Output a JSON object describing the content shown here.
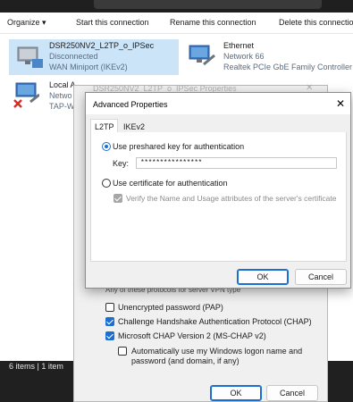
{
  "toolbar": {
    "organize": "Organize ▾",
    "start": "Start this connection",
    "rename": "Rename this connection",
    "delete": "Delete this connectio"
  },
  "connections": [
    {
      "title": "DSR250NV2_L2TP_o_IPSec",
      "line2": "Disconnected",
      "line3": "WAN Miniport (IKEv2)"
    },
    {
      "title": "Ethernet",
      "line2": "Network 66",
      "line3": "Realtek PCIe GbE Family Controller"
    },
    {
      "title": "Local A",
      "line2": "Netwo",
      "line3": "TAP-W"
    }
  ],
  "status_bar": {
    "text": "6 items  |  1 item"
  },
  "back_dialog": {
    "title": "DSR250NV2_L2TP_o_IPSec Properties",
    "close": "✕",
    "partial_label": "Any of these protocols for server VPN type",
    "options": [
      {
        "label": "Unencrypted password (PAP)",
        "checked": false
      },
      {
        "label": "Challenge Handshake Authentication Protocol (CHAP)",
        "checked": true
      },
      {
        "label": "Microsoft CHAP Version 2 (MS-CHAP v2)",
        "checked": true
      }
    ],
    "auto_logon_line1": "Automatically use my Windows logon name and",
    "auto_logon_line2": "password (and domain, if any)",
    "ok": "OK",
    "cancel": "Cancel"
  },
  "advanced": {
    "title": "Advanced Properties",
    "close": "✕",
    "tabs": [
      "L2TP",
      "IKEv2"
    ],
    "radio_psk": "Use preshared key for authentication",
    "key_label": "Key:",
    "key_value": "****************",
    "radio_cert": "Use certificate for authentication",
    "verify_label": "Verify the Name and Usage attributes of the server's certificate",
    "ok": "OK",
    "cancel": "Cancel"
  },
  "colors": {
    "accent": "#1a6fd1",
    "selection": "#cce4f7",
    "statusbar": "#202020"
  }
}
